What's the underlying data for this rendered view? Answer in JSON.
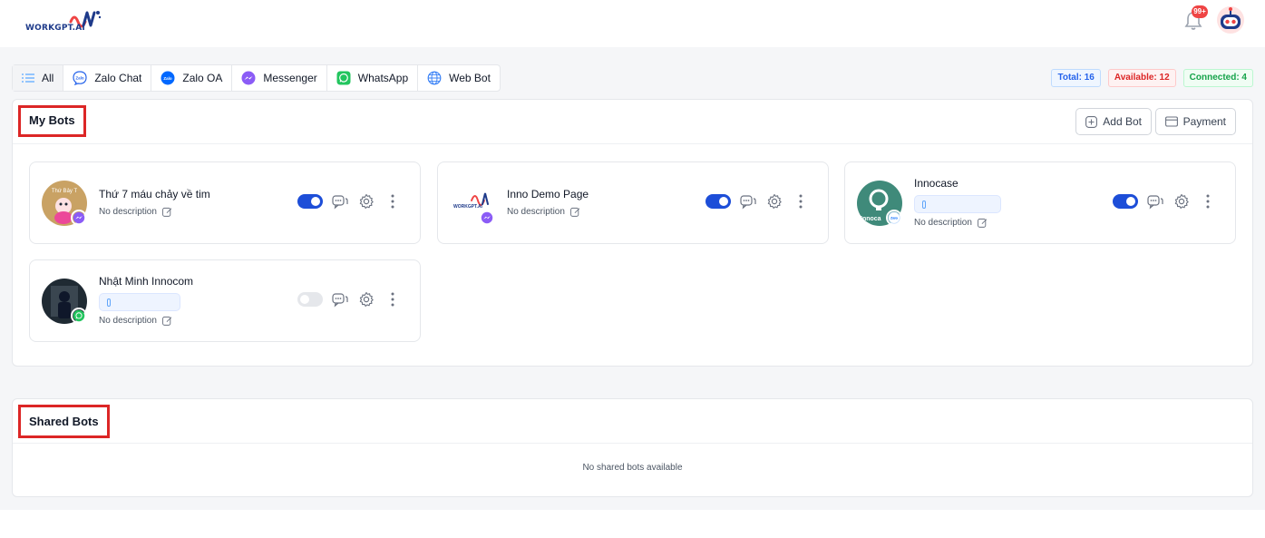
{
  "brand": {
    "logo_text": "WORKGPT.AI"
  },
  "header": {
    "notification_count": "99+"
  },
  "tabs": [
    {
      "label": "All",
      "icon": "list-icon"
    },
    {
      "label": "Zalo Chat",
      "icon": "zalo-chat-icon"
    },
    {
      "label": "Zalo OA",
      "icon": "zalo-oa-icon"
    },
    {
      "label": "Messenger",
      "icon": "messenger-icon"
    },
    {
      "label": "WhatsApp",
      "icon": "whatsapp-icon"
    },
    {
      "label": "Web Bot",
      "icon": "globe-icon"
    }
  ],
  "stats": {
    "total": "Total: 16",
    "available": "Available: 12",
    "connected": "Connected: 4"
  },
  "my_bots": {
    "title": "My Bots",
    "add_label": "Add Bot",
    "payment_label": "Payment",
    "bots": [
      {
        "name": "Thứ 7 máu chảy về tim",
        "description": "No description",
        "channel": "messenger",
        "enabled": true,
        "avatar_text": "Thứ Bảy T"
      },
      {
        "name": "Inno Demo Page",
        "description": "No description",
        "channel": "messenger",
        "enabled": true,
        "avatar_text": "WORKGPT.AI"
      },
      {
        "name": "Innocase",
        "description": "No description",
        "channel": "zalo",
        "enabled": true,
        "avatar_text": "Innoca",
        "badge_text": "Zalo"
      },
      {
        "name": "Nhật Minh Innocom",
        "description": "No description",
        "channel": "whatsapp",
        "enabled": false
      }
    ]
  },
  "shared_bots": {
    "title": "Shared Bots",
    "empty": "No shared bots available"
  },
  "colors": {
    "primary": "#1d4ed8",
    "highlight_border": "#dc2626",
    "messenger": "#a855f7",
    "whatsapp": "#22c55e",
    "zalo": "#0068ff"
  }
}
